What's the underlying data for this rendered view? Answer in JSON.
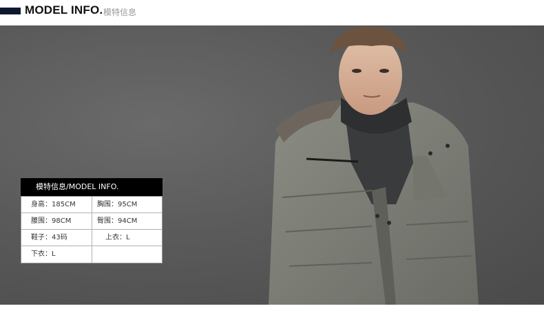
{
  "header": {
    "title": "MODEL INFO.",
    "subtitle": "模特信息"
  },
  "info_card": {
    "heading": "模特信息/MODEL INFO.",
    "rows": [
      [
        "身高：185CM",
        "胸围：95CM"
      ],
      [
        "腰围：98CM",
        "臀围：94CM"
      ],
      [
        "鞋子：43码",
        "上衣：L"
      ],
      [
        "下衣：L",
        ""
      ]
    ]
  },
  "colors": {
    "header_bar": "#101830",
    "backdrop": "#5a5a5a",
    "jacket": "#7e7f77"
  }
}
